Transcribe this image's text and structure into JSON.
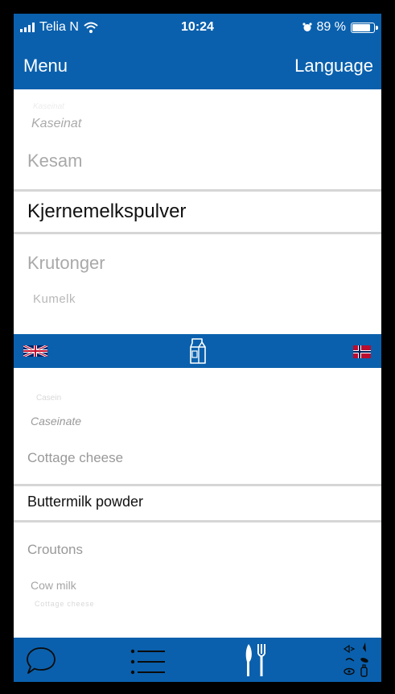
{
  "status": {
    "carrier": "Telia N",
    "time": "10:24",
    "battery": "89 %",
    "battery_level": 0.89
  },
  "nav": {
    "menu": "Menu",
    "language": "Language"
  },
  "norwegian": {
    "above": [
      "Kaseinat",
      "Kesam"
    ],
    "selected": "Kjernemelkspulver",
    "below": [
      "Krutonger",
      "Kumelk"
    ]
  },
  "english": {
    "above": [
      "Casein",
      "Caseinate",
      "Cottage cheese"
    ],
    "selected": "Buttermilk powder",
    "below": [
      "Croutons",
      "Cow milk",
      "Cottage cheese"
    ]
  },
  "colors": {
    "brand": "#0a60ad"
  },
  "icons": {
    "source_flag": "uk-flag",
    "category": "milk-carton",
    "target_flag": "norway-flag",
    "tabs": [
      "chat-bubble",
      "list",
      "cutlery",
      "allergen-symbols"
    ]
  }
}
